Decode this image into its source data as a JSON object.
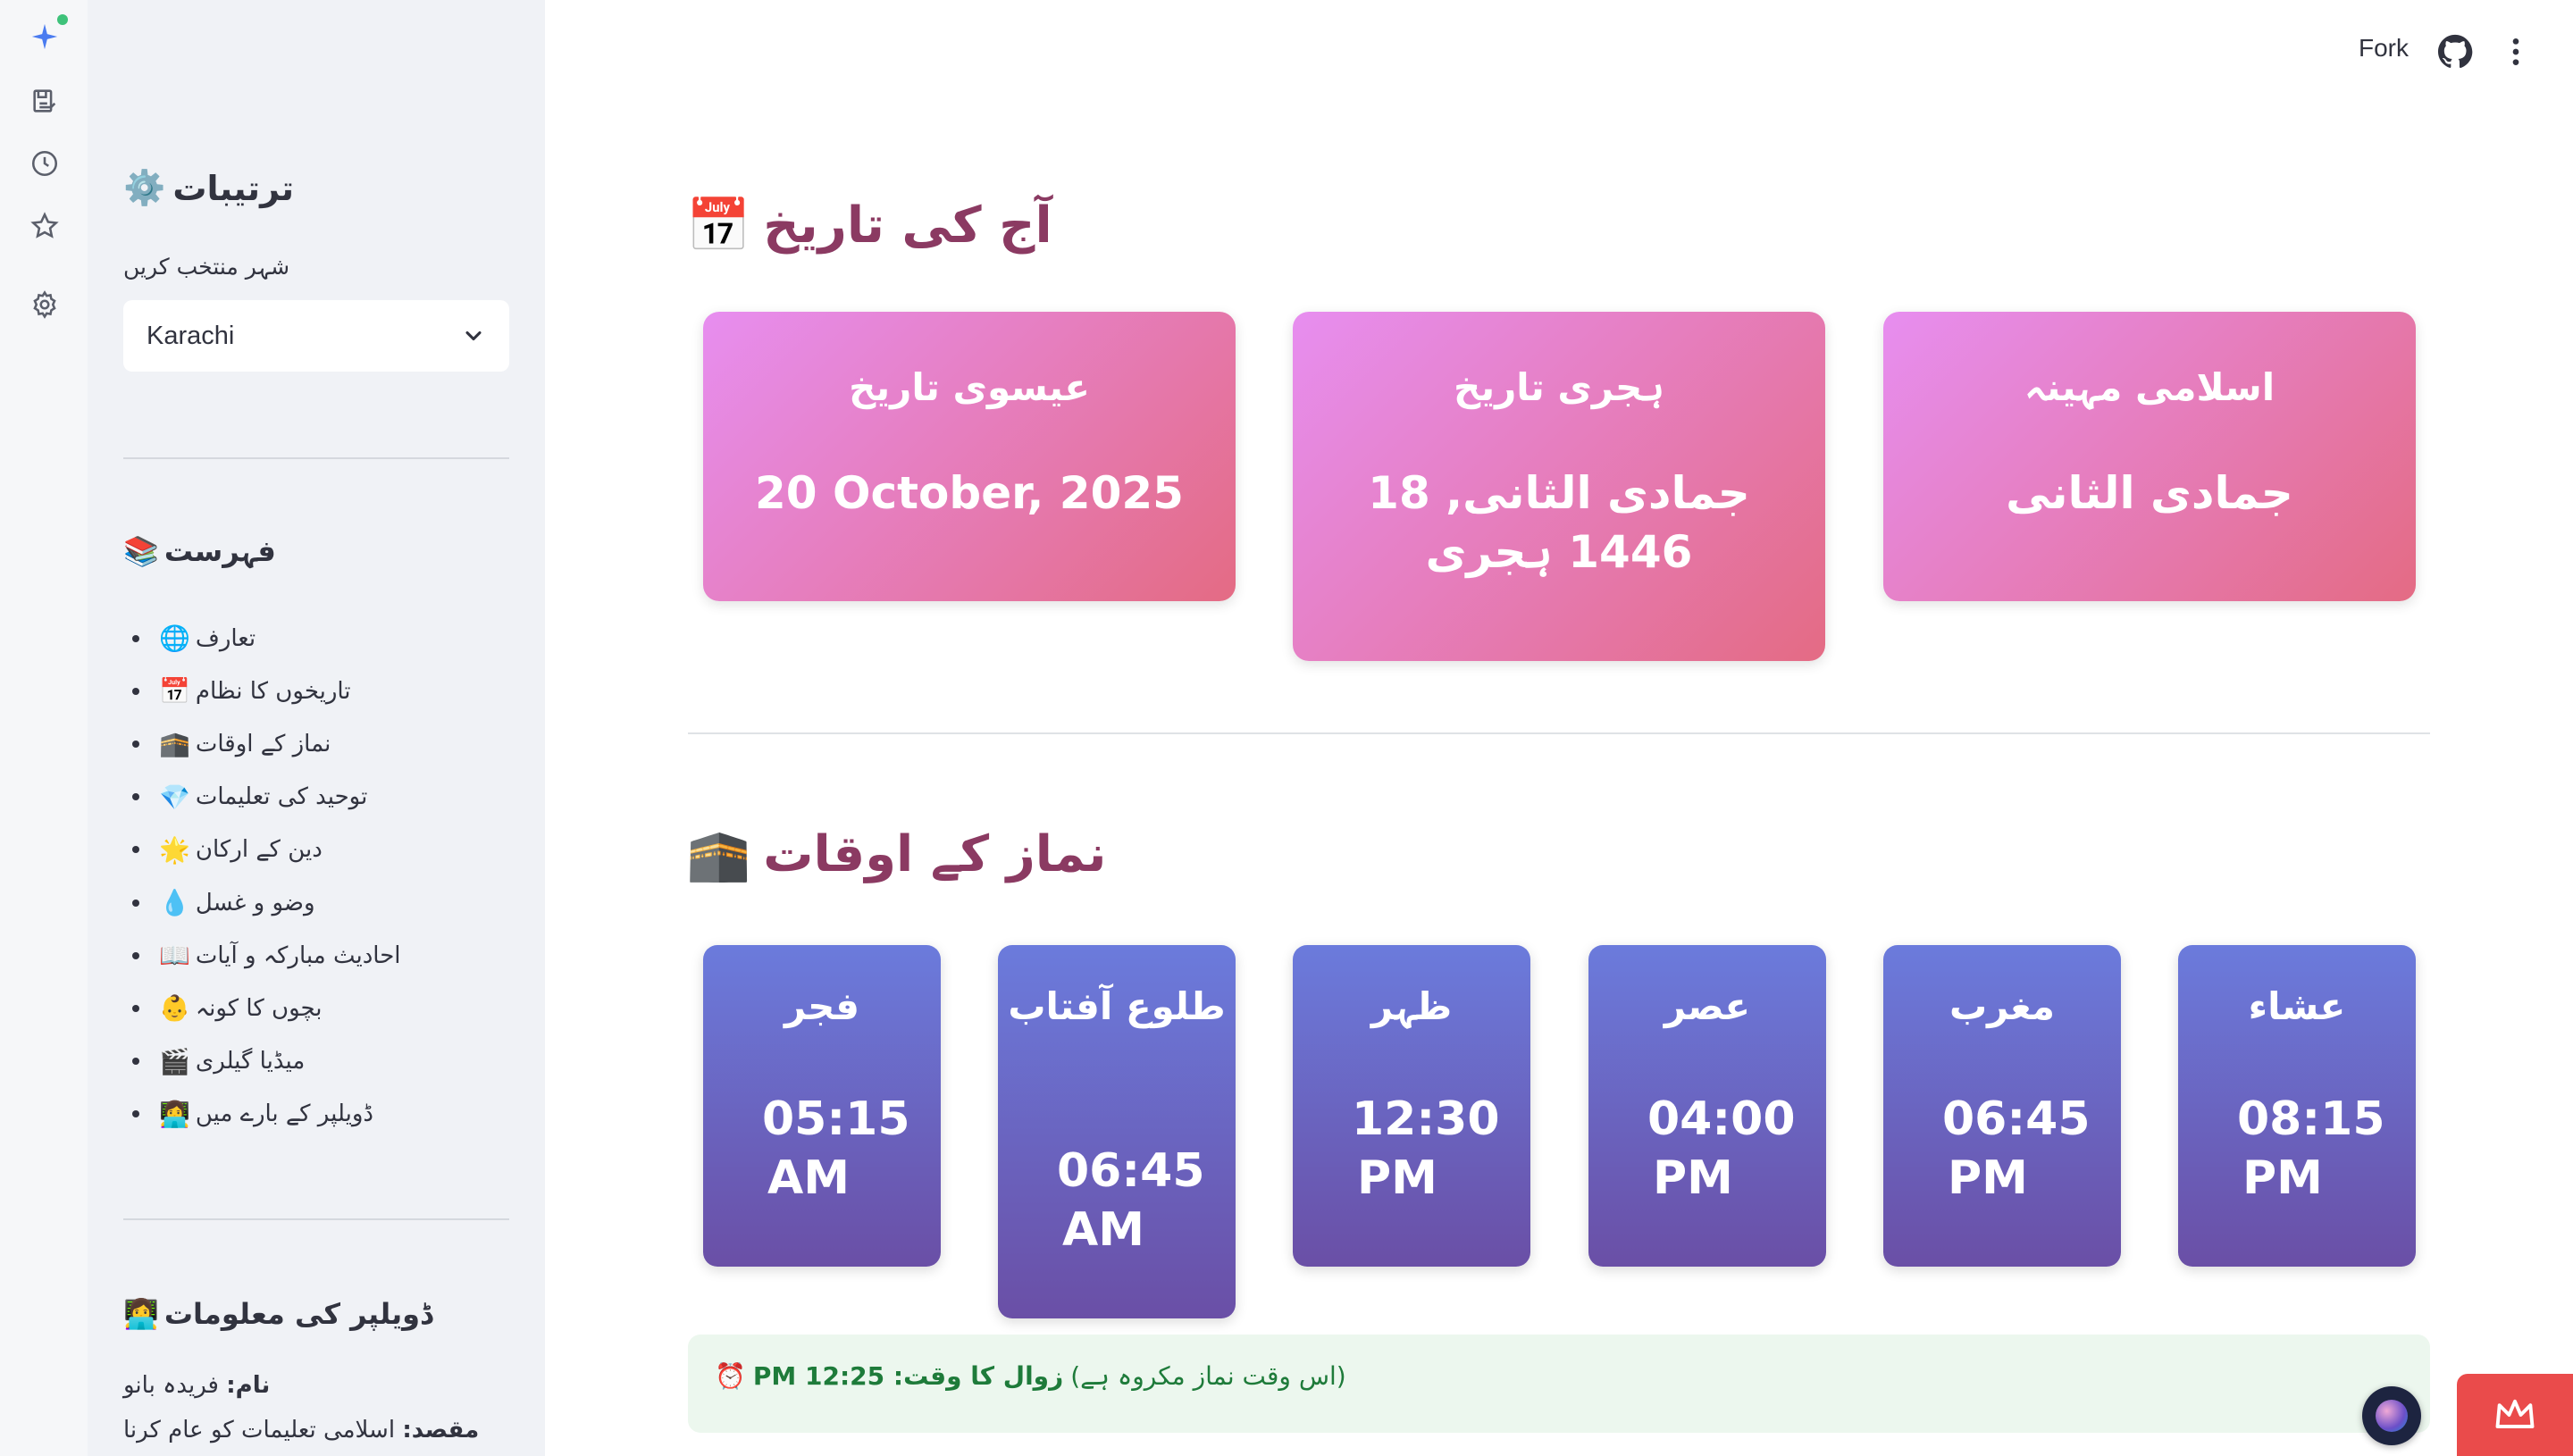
{
  "rail": {
    "icons": [
      "sparkle-icon",
      "save-icon",
      "clock-icon",
      "star-icon",
      "settings-icon"
    ]
  },
  "sidebar": {
    "title": "ترتیبات",
    "title_emoji": "⚙️",
    "city_label": "شہر منتخب کریں",
    "city_value": "Karachi",
    "toc_title": "فہرست",
    "toc_emoji": "📚",
    "toc_items": [
      {
        "emoji": "🌐",
        "label": "تعارف"
      },
      {
        "emoji": "📅",
        "label": "تاریخوں کا نظام"
      },
      {
        "emoji": "🕋",
        "label": "نماز کے اوقات"
      },
      {
        "emoji": "💎",
        "label": "توحید کی تعلیمات"
      },
      {
        "emoji": "🌟",
        "label": "دین کے ارکان"
      },
      {
        "emoji": "💧",
        "label": "وضو و غسل"
      },
      {
        "emoji": "📖",
        "label": "احادیث مبارکہ و آیات"
      },
      {
        "emoji": "👶",
        "label": "بچوں کا کونہ"
      },
      {
        "emoji": "🎬",
        "label": "میڈیا گیلری"
      },
      {
        "emoji": "👩‍💻",
        "label": "ڈویلپر کے بارے میں"
      }
    ],
    "dev_title": "ڈویلپر کی معلومات",
    "dev_emoji": "👩‍💻",
    "dev_name_key": "نام:",
    "dev_name_val": "فریدہ بانو",
    "dev_goal_key": "مقصد:",
    "dev_goal_val": "اسلامی تعلیمات کو عام کرنا"
  },
  "header": {
    "fork_label": "Fork",
    "github_icon": "github-icon",
    "menu_icon": "kebab-menu-icon"
  },
  "date_section": {
    "emoji": "📅",
    "title": "آج کی تاریخ",
    "cards": [
      {
        "caption": "عیسوی تاریخ",
        "value": "20 October, 2025"
      },
      {
        "caption": "ہجری تاریخ",
        "value": "جمادی الثانی, 18 1446 ہجری"
      },
      {
        "caption": "اسلامی مہینہ",
        "value": "جمادی الثانی"
      }
    ]
  },
  "prayer_section": {
    "emoji": "🕋",
    "title": "نماز کے اوقات",
    "prayers": [
      {
        "name": "فجر",
        "time_1": "05:15",
        "time_2": "AM"
      },
      {
        "name": "طلوع آفتاب",
        "time_1": "06:45",
        "time_2": "AM"
      },
      {
        "name": "ظہر",
        "time_1": "12:30",
        "time_2": "PM"
      },
      {
        "name": "عصر",
        "time_1": "04:00",
        "time_2": "PM"
      },
      {
        "name": "مغرب",
        "time_1": "06:45",
        "time_2": "PM"
      },
      {
        "name": "عشاء",
        "time_1": "08:15",
        "time_2": "PM"
      }
    ]
  },
  "zawal": {
    "emoji": "⏰",
    "label": "زوال کا وقت: 12:25 PM",
    "note": "(اس وقت نماز مکروہ ہے)"
  },
  "colors": {
    "accent_title": "#8b3a62",
    "pink_start": "#e78ef0",
    "pink_end": "#e46b84",
    "blue_start": "#6b7bdc",
    "blue_end": "#6a4fa6",
    "zawal_bg": "#ecf7ee",
    "zawal_text": "#1e7b3a"
  }
}
